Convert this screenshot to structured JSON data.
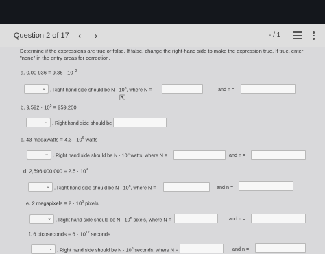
{
  "header": {
    "title": "Question 2 of 17",
    "prev": "‹",
    "next": "›",
    "score": "- / 1"
  },
  "instructions": "Determine if the expressions are true or false. If false, change the right-hand side to make the expression true. If true, enter \"none\" in the entry areas for correction.",
  "items": [
    {
      "label": "a. 0.00 936  =  9.36 · 10",
      "exp": "−2",
      "text": ". Right hand side should be N · 10",
      "text_exp": "n",
      "text_mid": ", where N =",
      "and_label": "and n ="
    },
    {
      "label": "b. 9.592 · 10",
      "label_exp": "5",
      "label_tail": " = 959,200",
      "text": ". Right hand side should be"
    },
    {
      "label": "c. 43 megawatts  =  4.3 · 10",
      "exp": "6",
      "label_tail": " watts",
      "text": ". Right hand side should be N · 10",
      "text_exp": "n",
      "text_mid": " watts, where N =",
      "and_label": "and n ="
    },
    {
      "label": "d. 2,596,000,000  =  2.5 · 10",
      "exp": "9",
      "text": ". Right hand side should be N · 10",
      "text_exp": "n",
      "text_mid": ", where N =",
      "and_label": "and n ="
    },
    {
      "label": "e. 2 megapixels  =  2 · 10",
      "exp": "6",
      "label_tail": " pixels",
      "text": ". Right hand side should be N · 10",
      "text_exp": "n",
      "text_mid": " pixels, where N =",
      "and_label": "and n ="
    },
    {
      "label": "f. 6 picoseconds  =  6 · 10",
      "exp": "12",
      "label_tail": " seconds",
      "text": ". Right hand side should be N · 10",
      "text_exp": "n",
      "text_mid": " seconds, where N =",
      "and_label": "and n ="
    }
  ],
  "dropdown_chevron": "⌄",
  "icons": [
    "list-icon",
    "more-vertical-icon",
    "chevron-left-icon",
    "chevron-right-icon",
    "mouse-cursor-icon"
  ]
}
